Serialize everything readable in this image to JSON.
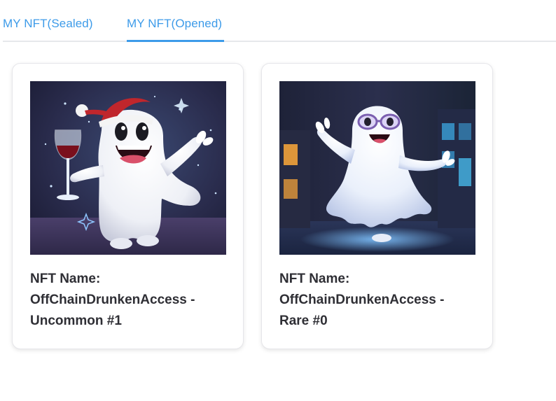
{
  "tabs": [
    {
      "label": "MY NFT(Sealed)",
      "active": false
    },
    {
      "label": "MY NFT(Opened)",
      "active": true
    }
  ],
  "accent_color": "#3d9be9",
  "cards": [
    {
      "name_label": "NFT Name:",
      "name_line1": "OffChainDrunkenAccess -",
      "name_line2": "Uncommon #1",
      "image": "ghost-with-santa-hat-and-wine-glass"
    },
    {
      "name_label": "NFT Name:",
      "name_line1": "OffChainDrunkenAccess -",
      "name_line2": "Rare #0",
      "image": "ghost-with-glasses-dancing"
    }
  ]
}
